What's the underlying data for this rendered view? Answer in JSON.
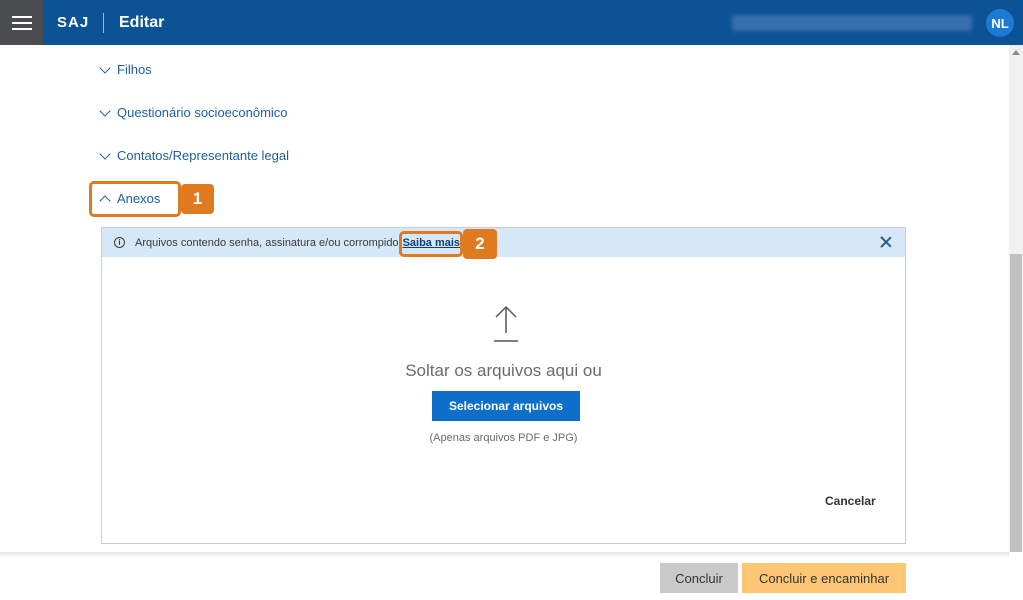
{
  "header": {
    "brand": "SAJ",
    "title": "Editar",
    "user_initials": "NL",
    "menu_icon": "hamburger-menu-icon"
  },
  "sections": [
    {
      "label": "Filhos",
      "state": "collapsed"
    },
    {
      "label": "Questionário socioeconômico",
      "state": "collapsed"
    },
    {
      "label": "Contatos/Representante legal",
      "state": "collapsed"
    },
    {
      "label": "Anexos",
      "state": "expanded"
    }
  ],
  "callouts": [
    "1",
    "2"
  ],
  "attachments": {
    "info_text": "Arquivos contendo senha, assinatura e/ou corrompido",
    "info_link": "Saiba mais",
    "drop_text": "Soltar os arquivos aqui ou",
    "select_button": "Selecionar arquivos",
    "hint": "(Apenas arquivos PDF e JPG)",
    "cancel": "Cancelar"
  },
  "footer": {
    "concluir": "Concluir",
    "concluir_encaminhar": "Concluir e encaminhar"
  },
  "colors": {
    "header_bg": "#0c5396",
    "accent_blue": "#0d6fc9",
    "callout_orange": "#e07a1f",
    "info_bg": "#d6e8f7",
    "forward_button": "#fcc675"
  }
}
